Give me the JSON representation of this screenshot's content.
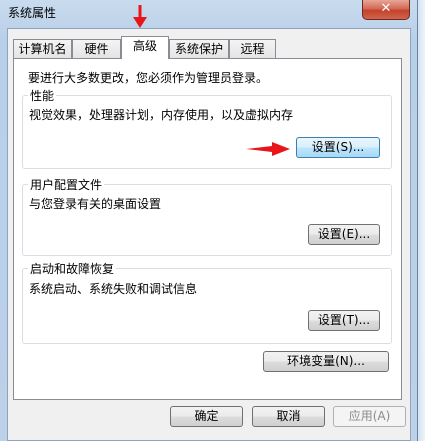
{
  "window": {
    "title": "系统属性",
    "close_glyph": "✕"
  },
  "tabs": [
    {
      "label": "计算机名"
    },
    {
      "label": "硬件"
    },
    {
      "label": "高级"
    },
    {
      "label": "系统保护"
    },
    {
      "label": "远程"
    }
  ],
  "active_tab": "高级",
  "advanced": {
    "admin_note": "要进行大多数更改，您必须作为管理员登录。",
    "performance": {
      "title": "性能",
      "description": "视觉效果，处理器计划，内存使用，以及虚拟内存",
      "button": "设置(S)..."
    },
    "user_profiles": {
      "title": "用户配置文件",
      "description": "与您登录有关的桌面设置",
      "button": "设置(E)..."
    },
    "startup_recovery": {
      "title": "启动和故障恢复",
      "description": "系统启动、系统失败和调试信息",
      "button": "设置(T)..."
    },
    "env_button": "环境变量(N)..."
  },
  "footer": {
    "ok": "确定",
    "cancel": "取消",
    "apply": "应用(A)"
  },
  "annotations": {
    "arrow_color": "#e8151b"
  }
}
